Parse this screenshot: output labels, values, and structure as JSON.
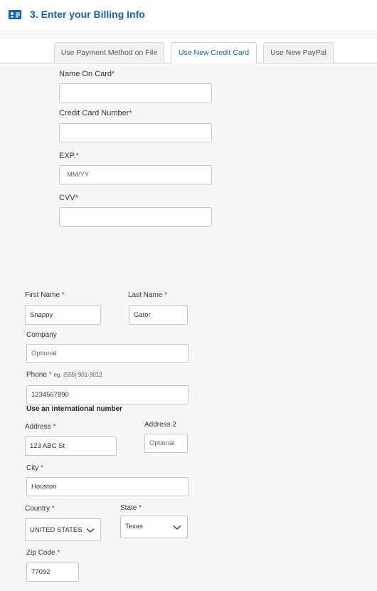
{
  "header": {
    "title": "3. Enter your Billing Info",
    "icon": "id-card-icon",
    "accent_color": "#1a5fa0"
  },
  "tabs": [
    {
      "label": "Use Payment Method on File",
      "active": false
    },
    {
      "label": "Use New Credit Card",
      "active": true
    },
    {
      "label": "Use New PayPal",
      "active": false
    }
  ],
  "card_form": {
    "name_on_card": {
      "label": "Name On Card",
      "required": "*",
      "value": ""
    },
    "card_number": {
      "label": "Credit Card Number",
      "required": "*",
      "value": ""
    },
    "exp": {
      "label": "EXP.",
      "required": "*",
      "placeholder": "MM/YY"
    },
    "cvv": {
      "label": "CVV",
      "required": "*",
      "value": ""
    }
  },
  "billing": {
    "first_name": {
      "label": "First Name",
      "required": "*",
      "value": "Snappy"
    },
    "last_name": {
      "label": "Last Name",
      "required": "*",
      "value": "Gator"
    },
    "company": {
      "label": "Company",
      "placeholder": "Optional"
    },
    "phone": {
      "label": "Phone",
      "required": "*",
      "hint": "eg. (555) 901-9012",
      "value": "1234567890",
      "intl_link": "Use an international number"
    },
    "address": {
      "label": "Address",
      "required": "*",
      "value": "123 ABC St"
    },
    "address2": {
      "label": "Address 2",
      "placeholder": "Optional"
    },
    "city": {
      "label": "City",
      "required": "*",
      "value": "Houston"
    },
    "country": {
      "label": "Country",
      "required": "*",
      "value": "UNITED STATES"
    },
    "state": {
      "label": "State",
      "required": "*",
      "value": "Texas"
    },
    "zip": {
      "label": "Zip Code",
      "required": "*",
      "value": "77092"
    }
  }
}
